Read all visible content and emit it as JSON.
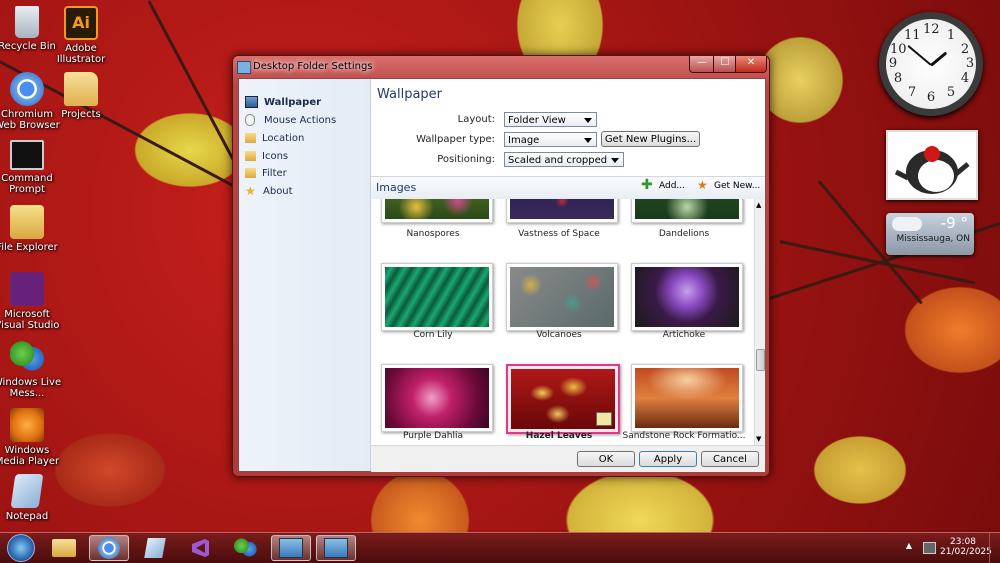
{
  "desktop_icons": [
    {
      "label": "Recycle Bin",
      "icon": "recycle-bin-icon"
    },
    {
      "label": "Chromium Web Browser",
      "icon": "chromium-icon"
    },
    {
      "label": "Command Prompt",
      "icon": "command-prompt-icon"
    },
    {
      "label": "File Explorer",
      "icon": "file-explorer-icon"
    },
    {
      "label": "Microsoft Visual Studio",
      "icon": "visual-studio-icon"
    },
    {
      "label": "Windows Live Mess...",
      "icon": "live-messenger-icon"
    },
    {
      "label": "Windows Media Player",
      "icon": "media-player-icon"
    },
    {
      "label": "Notepad",
      "icon": "notepad-icon"
    },
    {
      "label": "Adobe Illustrator",
      "icon": "illustrator-icon",
      "glyph": "Ai"
    },
    {
      "label": "Projects",
      "icon": "folder-icon"
    }
  ],
  "clock_gadget": {
    "numbers": [
      "12",
      "1",
      "2",
      "3",
      "4",
      "5",
      "6",
      "7",
      "8",
      "9",
      "10",
      "11"
    ]
  },
  "weather_gadget": {
    "temperature": "-9 °",
    "location": "Mississauga, ON"
  },
  "window": {
    "title": "Desktop Folder Settings",
    "caption_buttons": {
      "minimize": "—",
      "maximize": "☐",
      "close": "✕"
    },
    "sidebar": [
      {
        "label": "Wallpaper",
        "icon": "wallpaper-icon",
        "selected": true
      },
      {
        "label": "Mouse Actions",
        "icon": "mouse-icon"
      },
      {
        "label": "Location",
        "icon": "folder-icon"
      },
      {
        "label": "Icons",
        "icon": "folder-icon"
      },
      {
        "label": "Filter",
        "icon": "folder-icon"
      },
      {
        "label": "About",
        "icon": "star-icon"
      }
    ],
    "heading": "Wallpaper",
    "fields": {
      "layout_label": "Layout:",
      "layout_value": "Folder View",
      "type_label": "Wallpaper type:",
      "type_value": "Image",
      "plugins_button": "Get New Plugins...",
      "positioning_label": "Positioning:",
      "positioning_value": "Scaled and cropped"
    },
    "images_bar": {
      "title": "Images",
      "add": "Add...",
      "get_new": "Get New..."
    },
    "gallery": [
      {
        "name": "Nanospores"
      },
      {
        "name": "Vastness of Space"
      },
      {
        "name": "Dandelions"
      },
      {
        "name": "Corn Lily"
      },
      {
        "name": "Volcanoes"
      },
      {
        "name": "Artichoke"
      },
      {
        "name": "Purple Dahlia"
      },
      {
        "name": "Hazel Leaves",
        "selected": true
      },
      {
        "name": "Sandstone Rock Formatio..."
      }
    ],
    "buttons": {
      "ok": "OK",
      "apply": "Apply",
      "cancel": "Cancel"
    }
  },
  "taskbar": {
    "items": [
      "start-orb-icon",
      "file-explorer-icon",
      "chromium-icon",
      "notepad-icon",
      "visual-studio-icon",
      "live-messenger-icon",
      "desktop-folder-settings-icon",
      "desktop-folder-settings-icon"
    ],
    "time": "23:08",
    "date": "21/02/2025",
    "tray_arrow": "▲"
  },
  "colors": {
    "accent": "#1e3a6e",
    "selection": "#e23a8a",
    "taskbar": "#5a1010"
  }
}
